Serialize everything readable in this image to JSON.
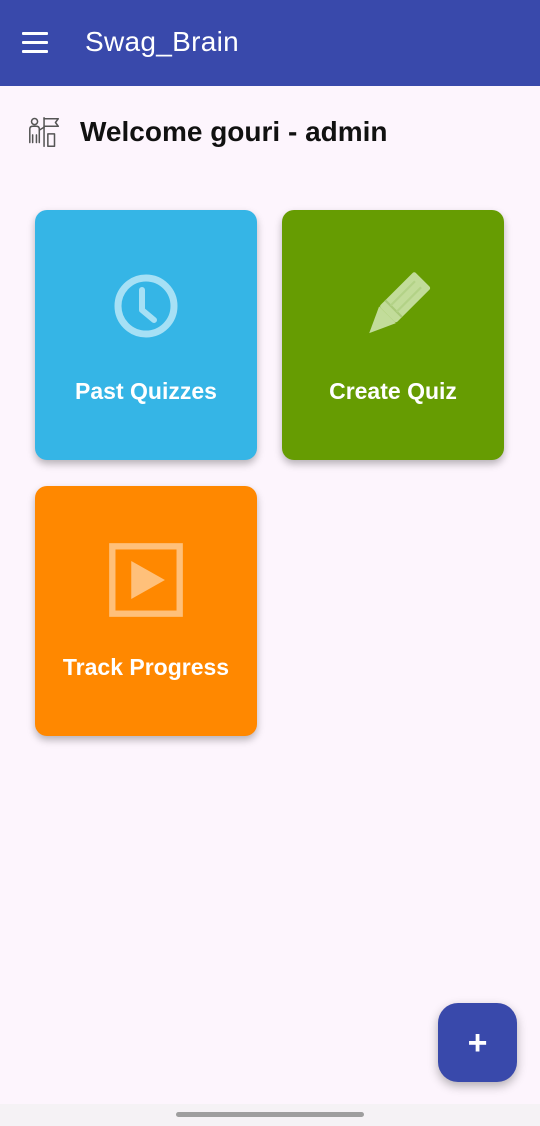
{
  "appbar": {
    "title": "Swag_Brain",
    "menu_icon": "hamburger-menu-icon",
    "color": "#3949ab"
  },
  "welcome": {
    "icon": "user-flag-icon",
    "text": "Welcome gouri - admin"
  },
  "tiles": [
    {
      "label": "Past Quizzes",
      "icon": "clock-icon",
      "color": "#35b5e6"
    },
    {
      "label": "Create Quiz",
      "icon": "pencil-icon",
      "color": "#669c02"
    },
    {
      "label": "Track Progress",
      "icon": "play-icon",
      "color": "#ff8800"
    }
  ],
  "fab": {
    "glyph": "+",
    "icon": "add-icon",
    "color": "#3949ab"
  }
}
